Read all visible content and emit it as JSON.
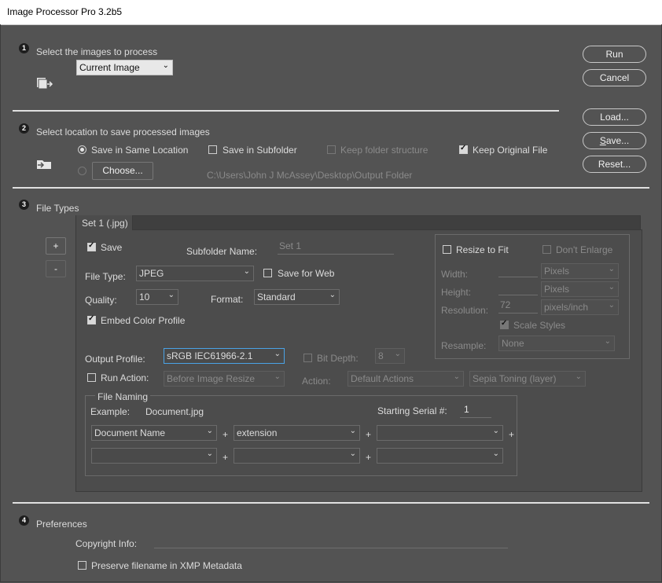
{
  "window": {
    "title": "Image Processor Pro 3.2b5"
  },
  "sec1": {
    "number": "1",
    "title": "Select the images to process",
    "source": "Current Image"
  },
  "sec2": {
    "number": "2",
    "title": "Select location to save processed images",
    "same_location": "Save in Same Location",
    "subfolder": "Save in Subfolder",
    "keep_structure": "Keep folder structure",
    "keep_original": "Keep Original File",
    "choose": "Choose...",
    "path": "C:\\Users\\John J McAssey\\Desktop\\Output Folder"
  },
  "buttons": {
    "run": "Run",
    "cancel": "Cancel",
    "load": "Load...",
    "save": "Save...",
    "reset": "Reset..."
  },
  "sec3": {
    "number": "3",
    "title": "File Types",
    "tab": "Set 1 (.jpg)",
    "add": "+",
    "remove": "-",
    "save": "Save",
    "subfolder_label": "Subfolder Name:",
    "subfolder_value": "Set 1",
    "file_type_label": "File Type:",
    "file_type": "JPEG",
    "save_for_web": "Save for Web",
    "quality_label": "Quality:",
    "quality": "10",
    "format_label": "Format:",
    "format": "Standard",
    "embed_profile": "Embed Color Profile",
    "output_profile_label": "Output Profile:",
    "output_profile": "sRGB IEC61966-2.1",
    "bit_depth_label": "Bit Depth:",
    "bit_depth": "8",
    "run_action": "Run Action:",
    "action_when": "Before Image Resize",
    "action_label": "Action:",
    "action_set": "Default Actions",
    "action": "Sepia Toning (layer)",
    "resize": {
      "fit": "Resize to Fit",
      "dont_enlarge": "Don't Enlarge",
      "width_label": "Width:",
      "width_unit": "Pixels",
      "height_label": "Height:",
      "height_unit": "Pixels",
      "res_label": "Resolution:",
      "res_value": "72",
      "res_unit": "pixels/inch",
      "scale_styles": "Scale Styles",
      "resample_label": "Resample:",
      "resample": "None"
    },
    "naming": {
      "title": "File Naming",
      "example_label": "Example:",
      "example": "Document.jpg",
      "serial_label": "Starting Serial #:",
      "serial": "1",
      "f1": "Document Name",
      "f2": "extension",
      "plus": "+"
    }
  },
  "sec4": {
    "number": "4",
    "title": "Preferences",
    "copyright_label": "Copyright Info:",
    "preserve": "Preserve filename in XMP Metadata"
  }
}
